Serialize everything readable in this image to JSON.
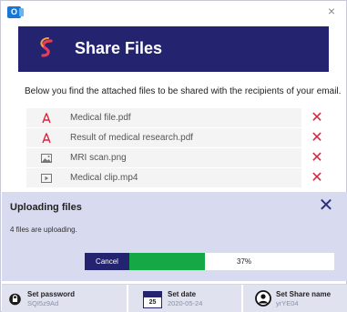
{
  "window": {
    "app_icon_letter": "O",
    "close_glyph": "×"
  },
  "header": {
    "title": "Share Files",
    "logo_color": "#e83c56",
    "background": "#232370"
  },
  "intro_text": "Below you find the attached files to be shared with the recipients of your email.",
  "files": [
    {
      "name": "Medical file.pdf",
      "icon": "pdf-icon"
    },
    {
      "name": "Result of medical research.pdf",
      "icon": "pdf-icon"
    },
    {
      "name": "MRI scan.png",
      "icon": "image-icon"
    },
    {
      "name": "Medical clip.mp4",
      "icon": "video-icon"
    }
  ],
  "file_remove_glyph": "✕",
  "upload": {
    "title": "Uploading files",
    "status": "4 files are uploading.",
    "cancel_label": "Cancel",
    "progress_percent": 37,
    "progress_text": "37%",
    "close_glyph": "✕",
    "progress_color": "#17a846"
  },
  "options": {
    "password": {
      "label": "Set password",
      "value": "SQI5z9Ad",
      "icon": "lock-icon"
    },
    "date": {
      "label": "Set date",
      "value": "2020-05-24",
      "calendar_day": "25",
      "icon": "calendar-icon"
    },
    "share_name": {
      "label": "Set Share name",
      "value": "yrYE04",
      "icon": "user-icon"
    }
  }
}
